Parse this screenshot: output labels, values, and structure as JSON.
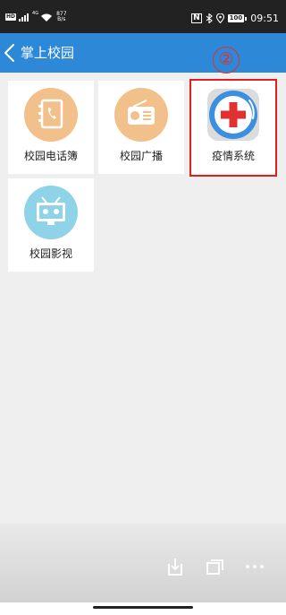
{
  "status_bar": {
    "hd": "HD",
    "signal_sup": "4G",
    "speed_value": "877",
    "speed_unit": "B/s",
    "nfc": "N",
    "battery": "100",
    "time": "09:51"
  },
  "header": {
    "title": "掌上校园",
    "back_icon": "chevron-left-icon"
  },
  "annotation": {
    "step_marker": "②",
    "highlight_color": "#e02020"
  },
  "tiles": [
    {
      "label": "校园电话簿",
      "icon": "phonebook-icon",
      "icon_bg": "#f2c08a"
    },
    {
      "label": "校园广播",
      "icon": "radio-icon",
      "icon_bg": "#f2c08a"
    },
    {
      "label": "疫情系统",
      "icon": "medical-cross-icon",
      "icon_bg": "#3a8fe0"
    },
    {
      "label": "校园影视",
      "icon": "tv-icon",
      "icon_bg": "#8fd3e8"
    }
  ],
  "bottom_bar": {
    "buttons": [
      "download-icon",
      "windows-icon",
      "more-icon"
    ]
  },
  "colors": {
    "header_bg": "#2e88d8",
    "status_bar_bg": "#222222",
    "page_bg": "#efefef"
  }
}
